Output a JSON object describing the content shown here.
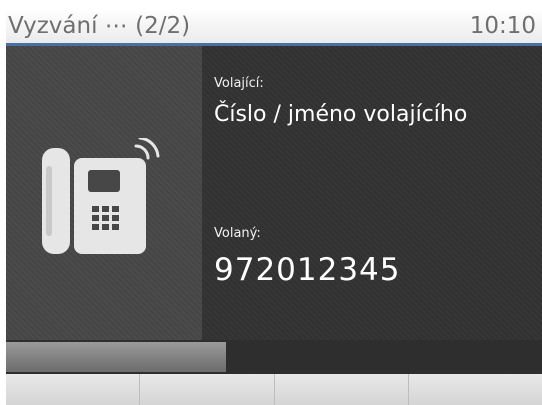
{
  "header": {
    "title": "Vyzvání ⋯ (2/2)",
    "time": "10:10"
  },
  "call": {
    "caller_label": "Volající:",
    "caller_value": "Číslo / jméno volajícího",
    "callee_label": "Volaný:",
    "callee_value": "972012345"
  },
  "icons": {
    "left_panel": "desk-phone-icon"
  },
  "progress": {
    "fraction": 0.41
  },
  "softkeys": [
    {
      "label": ""
    },
    {
      "label": ""
    },
    {
      "label": ""
    },
    {
      "label": ""
    }
  ],
  "colors": {
    "header_accent": "#4a6fa5",
    "background": "#3a3a3a"
  }
}
